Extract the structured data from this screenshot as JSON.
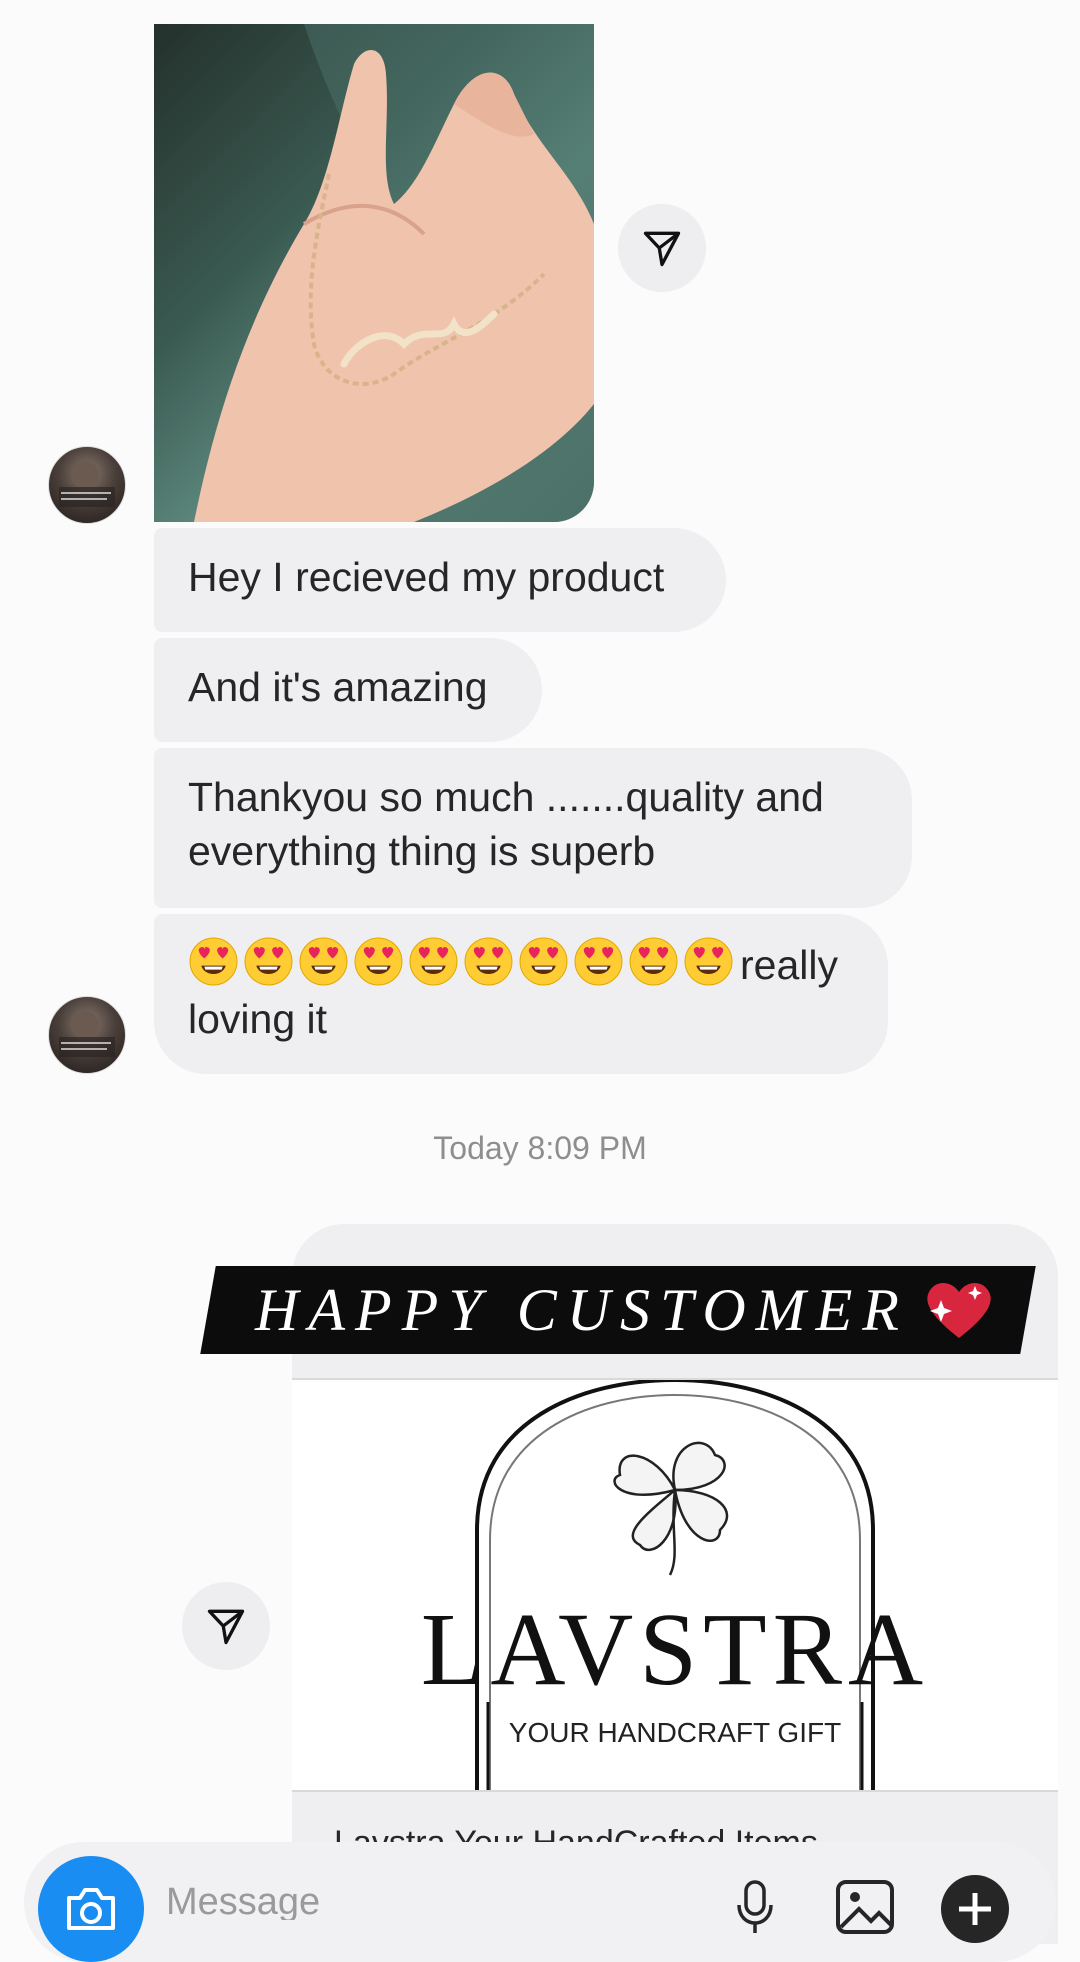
{
  "messages": [
    {
      "text": "Hey I recieved my product"
    },
    {
      "text": "And it's amazing"
    },
    {
      "text": "Thankyou so much .......quality and everything thing is superb"
    },
    {
      "emoji_count": 10,
      "emoji_name": "smiling-face-with-heart-eyes",
      "text": "really loving it"
    }
  ],
  "timestamp": "Today 8:09 PM",
  "shared_post": {
    "banner": "HAPPY CUSTOMER",
    "brand": "LAVSTRA",
    "tagline": "YOUR HANDCRAFT GIFT",
    "caption": "Lavstra Your HandCrafted Items"
  },
  "composer": {
    "placeholder": "Message",
    "icons": [
      "camera-icon",
      "microphone-icon",
      "gallery-icon",
      "plus-icon"
    ]
  },
  "colors": {
    "bubble": "#efeef1",
    "accent": "#1a8df3",
    "timestamp": "#8e8e8e"
  }
}
